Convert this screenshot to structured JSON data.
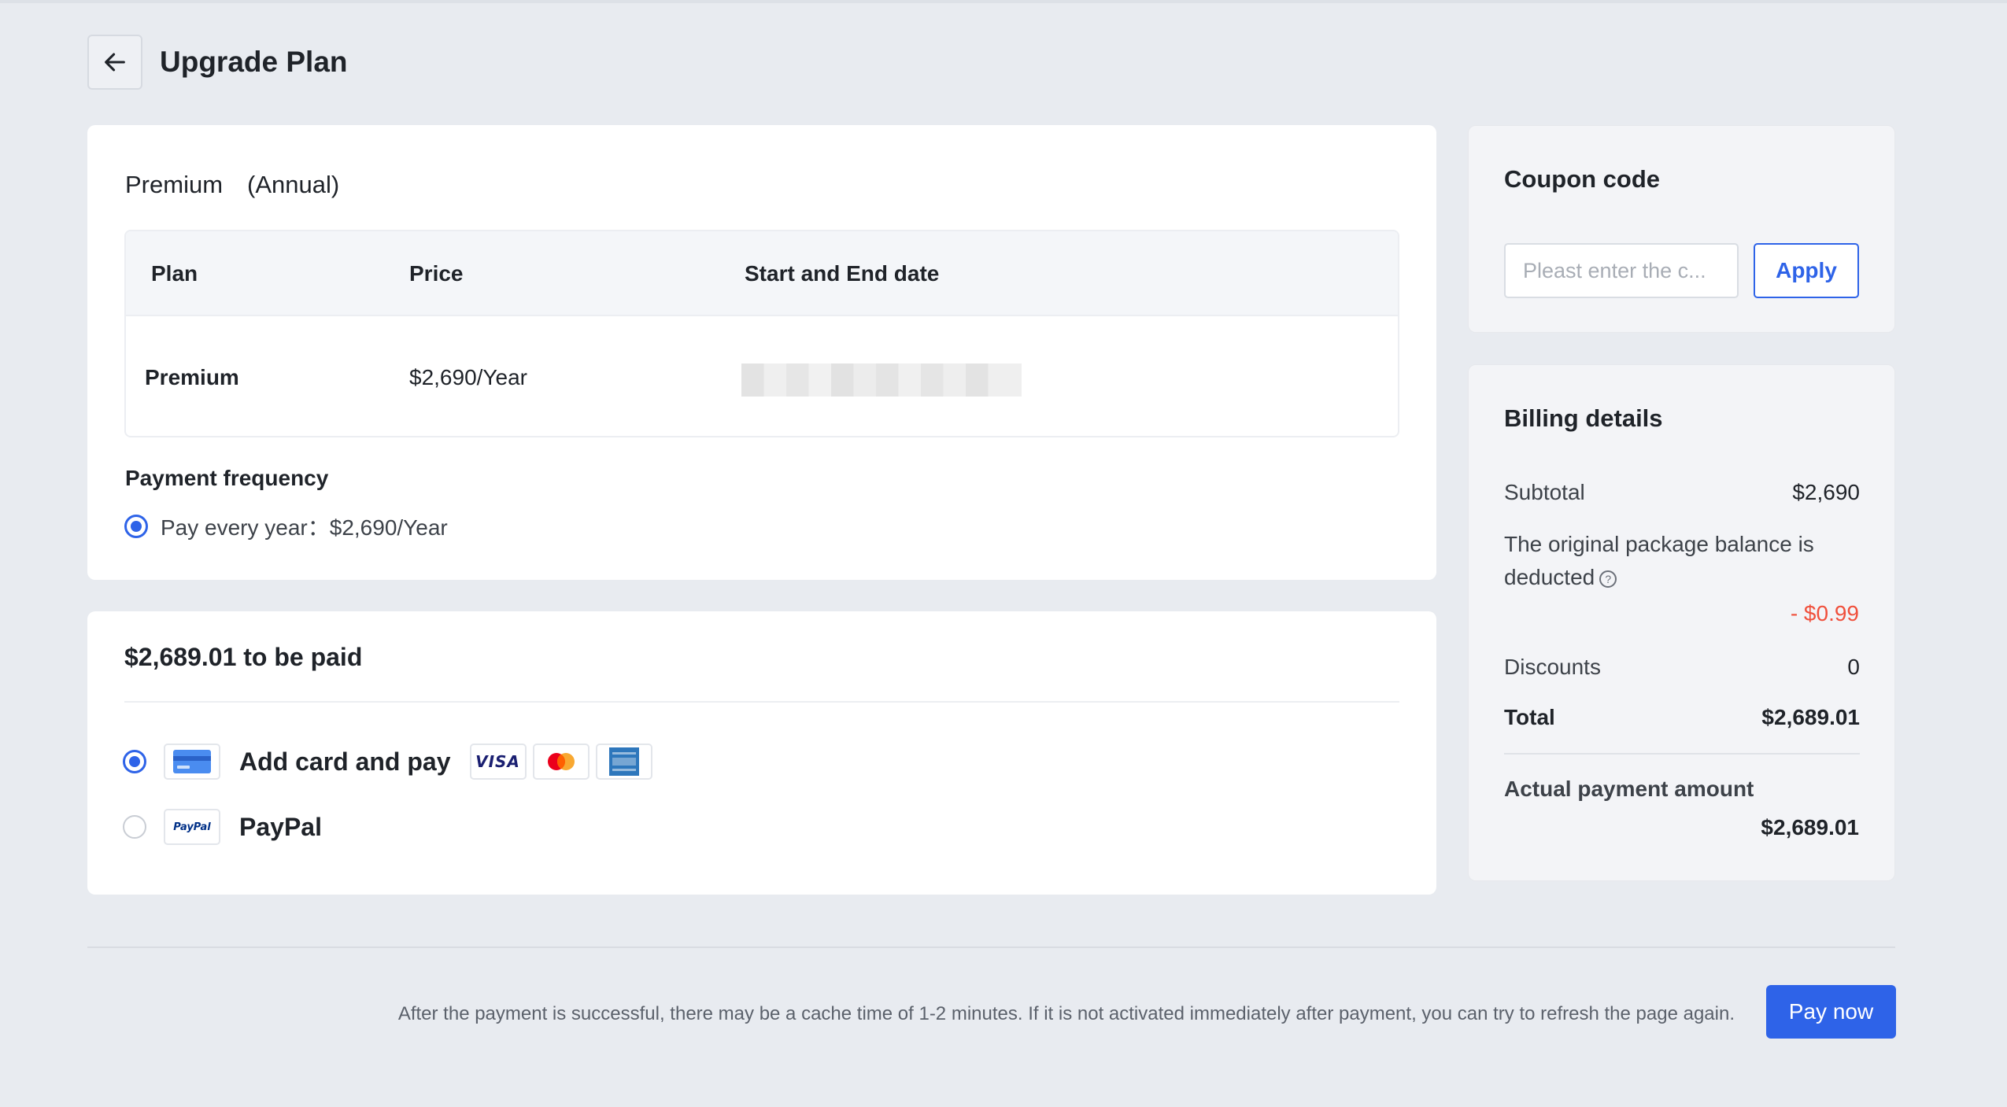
{
  "header": {
    "title": "Upgrade Plan",
    "back_icon": "arrow-left-icon"
  },
  "plan": {
    "title": "Premium　(Annual)",
    "table": {
      "columns": [
        "Plan",
        "Price",
        "Start and End date"
      ],
      "rows": [
        {
          "plan": "Premium",
          "price": "$2,690/Year",
          "dates": ""
        }
      ]
    },
    "frequency_label": "Payment frequency",
    "frequency_option": "Pay every year：$2,690/Year",
    "frequency_selected": true
  },
  "payment": {
    "amount_due": "$2,689.01 to be paid",
    "methods": [
      {
        "label": "Add card and pay",
        "icon": "credit-card-icon",
        "selected": true,
        "brands": [
          "VISA",
          "mastercard",
          "american-express"
        ]
      },
      {
        "label": "PayPal",
        "icon": "paypal-icon",
        "selected": false,
        "icon_text": "PayPal"
      }
    ]
  },
  "coupon": {
    "title": "Coupon code",
    "placeholder": "Pleast enter the c...",
    "apply_label": "Apply"
  },
  "billing": {
    "title": "Billing details",
    "subtotal_label": "Subtotal",
    "subtotal_value": "$2,690",
    "balance_label": "The original package balance is deducted",
    "balance_value": "- $0.99",
    "discounts_label": "Discounts",
    "discounts_value": "0",
    "total_label": "Total",
    "total_value": "$2,689.01",
    "actual_label": "Actual payment amount",
    "actual_value": "$2,689.01"
  },
  "footer": {
    "note": "After the payment is successful, there may be a cache time of 1-2 minutes. If it is not activated immediately after payment, you can try to refresh the page again.",
    "pay_label": "Pay now"
  },
  "colors": {
    "accent": "#2e63e8",
    "negative": "#f0503c",
    "background": "#e8ebf0"
  }
}
